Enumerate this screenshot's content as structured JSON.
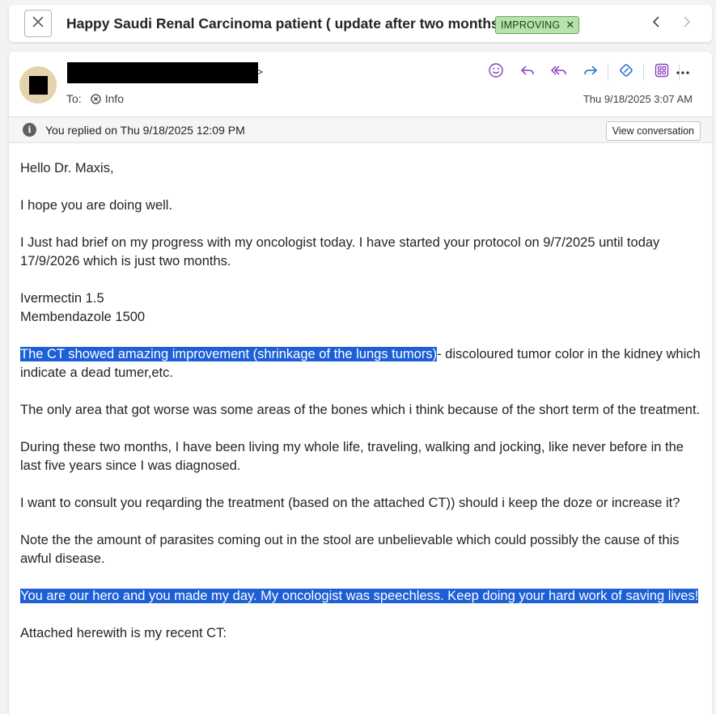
{
  "header": {
    "subject": "Happy Saudi Renal Carcinoma patient ( update after two months)",
    "tag_label": "IMPROVING",
    "tag_color": "#b8e1ad"
  },
  "message": {
    "to_label": "To:",
    "to_recipient": "Info",
    "datetime": "Thu 9/18/2025 3:07 AM",
    "sender_suffix": ">",
    "replied_notice": "You replied on Thu 9/18/2025 12:09 PM",
    "view_conversation_label": "View conversation"
  },
  "icons": {
    "close": "close-icon",
    "prev": "chevron-left-icon",
    "next": "chevron-right-icon",
    "emoji": "emoji-icon",
    "reply": "reply-icon",
    "reply_all": "reply-all-icon",
    "forward": "forward-icon",
    "immersive_reader": "immersive-reader-icon",
    "apps": "apps-icon",
    "more": "more-icon",
    "info": "info-icon"
  },
  "colors": {
    "accent_purple": "#8a3ec0",
    "accent_blue": "#2266d0",
    "highlight": "#1d5fd6",
    "tag_border": "#5fb14a"
  },
  "body": {
    "greeting": "Hello Dr. Maxis,",
    "p1": "I hope you are doing well.",
    "p2": "I Just had brief on my progress with my oncologist today. I have started your protocol on 9/7/2025 until today 17/9/2026 which is just two months.",
    "med1": "Ivermectin 1.5",
    "med2": "Membendazole 1500",
    "p3_highlight": "The CT showed amazing improvement (shrinkage of the lungs tumors)",
    "p3_rest": "- discoloured tumor color in the kidney which indicate a dead tumer,etc.",
    "p4": "The only area that got worse was some areas of the bones which i think because of the short term of the treatment.",
    "p5": "During these two months, I have been living my whole life, traveling, walking and jocking, like never before in the last five years since I was diagnosed.",
    "p6": "I want to consult you reqarding the treatment (based on the attached CT)) should i keep the doze or increase it?",
    "p7": "Note the the amount of parasites coming out in the stool are unbelievable which could possibly the cause of this awful disease.",
    "p8_highlight": "You are our hero and you made my day. My oncologist was speechless. Keep doing your hard work of saving lives!",
    "p9": "Attached herewith is my recent CT:"
  }
}
